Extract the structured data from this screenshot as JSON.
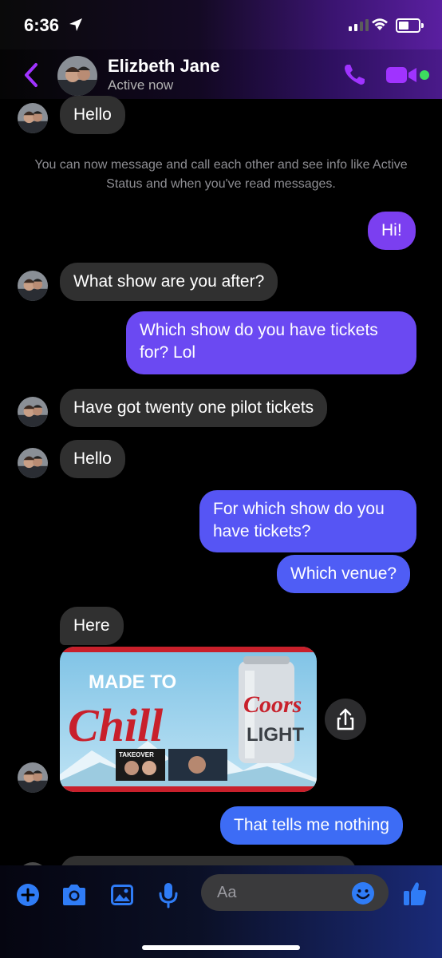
{
  "status_bar": {
    "time": "6:36"
  },
  "header": {
    "contact_name": "Elizbeth Jane",
    "contact_status": "Active now"
  },
  "notice": "You can now message and call each other and see info like Active Status and when you've read messages.",
  "colors": {
    "accent": "#a033ff",
    "outgoing_top": "#7b3ff0",
    "outgoing_bottom": "#3d6cf5",
    "incoming": "#303030"
  },
  "messages": [
    {
      "from": "them",
      "text": "Hello"
    },
    {
      "from": "me",
      "text": "Hi!"
    },
    {
      "from": "them",
      "text": "What show are you after?"
    },
    {
      "from": "me",
      "text_line1": "Which show do you have tickets",
      "text_line2": "for?  Lol"
    },
    {
      "from": "them",
      "text": "Have got twenty one pilot tickets"
    },
    {
      "from": "them",
      "text": "Hello"
    },
    {
      "from": "me",
      "text_line1": "For which show do you",
      "text_line2": "have tickets?"
    },
    {
      "from": "me",
      "text": "Which venue?"
    },
    {
      "from": "them",
      "text": "Here"
    },
    {
      "from": "them",
      "image": {
        "line1": "MADE TO",
        "line2": "Chill",
        "brand_line1": "Coors",
        "brand_line2": "LIGHT",
        "banner": "TAKEOVER"
      }
    },
    {
      "from": "me",
      "text": "That tells me nothing"
    }
  ],
  "composer": {
    "placeholder": "Aa"
  },
  "icons": [
    "back-icon",
    "phone-icon",
    "video-icon",
    "plus-icon",
    "camera-icon",
    "gallery-icon",
    "microphone-icon",
    "emoji-icon",
    "thumbs-up-icon",
    "share-icon"
  ]
}
